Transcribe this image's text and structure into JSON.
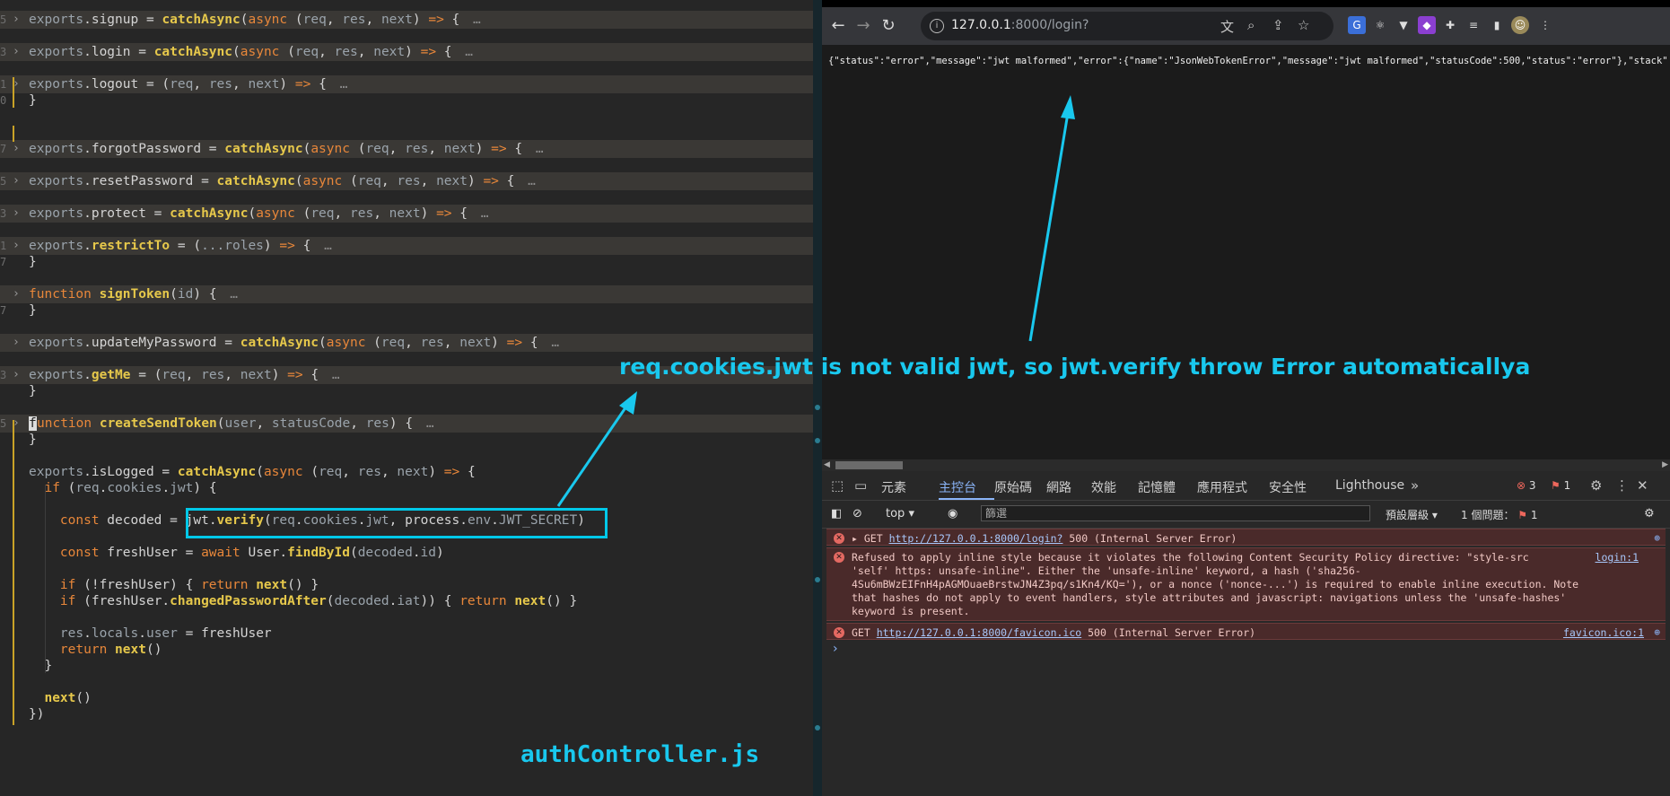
{
  "editor": {
    "filename_caption": "authController.js",
    "lines": [
      {
        "fold": true,
        "gutter": "5",
        "segs": [
          [
            "exports",
            "p"
          ],
          [
            ".",
            ""
          ],
          [
            "signup",
            ""
          ],
          [
            " = ",
            ""
          ],
          [
            "catchAsync",
            "f"
          ],
          [
            "(",
            ""
          ],
          [
            "async",
            "k"
          ],
          [
            " (",
            ""
          ],
          [
            "req",
            "p"
          ],
          [
            ", ",
            ""
          ],
          [
            "res",
            "p"
          ],
          [
            ", ",
            ""
          ],
          [
            "next",
            "p"
          ],
          [
            ") ",
            ""
          ],
          [
            "=>",
            "k"
          ],
          [
            " { ",
            ""
          ]
        ]
      },
      {
        "fold": true,
        "gutter": "3",
        "segs": [
          [
            "exports",
            "p"
          ],
          [
            ".",
            ""
          ],
          [
            "login",
            ""
          ],
          [
            " = ",
            ""
          ],
          [
            "catchAsync",
            "f"
          ],
          [
            "(",
            ""
          ],
          [
            "async",
            "k"
          ],
          [
            " (",
            ""
          ],
          [
            "req",
            "p"
          ],
          [
            ", ",
            ""
          ],
          [
            "res",
            "p"
          ],
          [
            ", ",
            ""
          ],
          [
            "next",
            "p"
          ],
          [
            ") ",
            ""
          ],
          [
            "=>",
            "k"
          ],
          [
            " { ",
            ""
          ]
        ]
      },
      {
        "fold": true,
        "gutter": "1",
        "segs": [
          [
            "exports",
            "p"
          ],
          [
            ".",
            ""
          ],
          [
            "logout",
            ""
          ],
          [
            " = (",
            ""
          ],
          [
            "req",
            "p"
          ],
          [
            ", ",
            ""
          ],
          [
            "res",
            "p"
          ],
          [
            ", ",
            ""
          ],
          [
            "next",
            "p"
          ],
          [
            ") ",
            ""
          ],
          [
            "=>",
            "k"
          ],
          [
            " { ",
            ""
          ]
        ]
      },
      {
        "fold": false,
        "gutter": "0",
        "segs": [
          [
            "}",
            ""
          ]
        ]
      },
      {
        "fold": false,
        "gutter": "",
        "segs": []
      },
      {
        "fold": true,
        "gutter": "7",
        "segs": [
          [
            "exports",
            "p"
          ],
          [
            ".",
            ""
          ],
          [
            "forgotPassword",
            ""
          ],
          [
            " = ",
            ""
          ],
          [
            "catchAsync",
            "f"
          ],
          [
            "(",
            ""
          ],
          [
            "async",
            "k"
          ],
          [
            " (",
            ""
          ],
          [
            "req",
            "p"
          ],
          [
            ", ",
            ""
          ],
          [
            "res",
            "p"
          ],
          [
            ", ",
            ""
          ],
          [
            "next",
            "p"
          ],
          [
            ") ",
            ""
          ],
          [
            "=>",
            "k"
          ],
          [
            " { ",
            ""
          ]
        ]
      },
      {
        "fold": true,
        "gutter": "5",
        "segs": [
          [
            "exports",
            "p"
          ],
          [
            ".",
            ""
          ],
          [
            "resetPassword",
            ""
          ],
          [
            " = ",
            ""
          ],
          [
            "catchAsync",
            "f"
          ],
          [
            "(",
            ""
          ],
          [
            "async",
            "k"
          ],
          [
            " (",
            ""
          ],
          [
            "req",
            "p"
          ],
          [
            ", ",
            ""
          ],
          [
            "res",
            "p"
          ],
          [
            ", ",
            ""
          ],
          [
            "next",
            "p"
          ],
          [
            ") ",
            ""
          ],
          [
            "=>",
            "k"
          ],
          [
            " { ",
            ""
          ]
        ]
      },
      {
        "fold": true,
        "gutter": "3",
        "segs": [
          [
            "exports",
            "p"
          ],
          [
            ".",
            ""
          ],
          [
            "protect",
            ""
          ],
          [
            " = ",
            ""
          ],
          [
            "catchAsync",
            "f"
          ],
          [
            "(",
            ""
          ],
          [
            "async",
            "k"
          ],
          [
            " (",
            ""
          ],
          [
            "req",
            "p"
          ],
          [
            ", ",
            ""
          ],
          [
            "res",
            "p"
          ],
          [
            ", ",
            ""
          ],
          [
            "next",
            "p"
          ],
          [
            ") ",
            ""
          ],
          [
            "=>",
            "k"
          ],
          [
            " { ",
            ""
          ]
        ]
      },
      {
        "fold": true,
        "gutter": "1",
        "segs": [
          [
            "exports",
            "p"
          ],
          [
            ".",
            ""
          ],
          [
            "restrictTo",
            "f"
          ],
          [
            " = (",
            ""
          ],
          [
            "...roles",
            "p"
          ],
          [
            ") ",
            ""
          ],
          [
            "=>",
            "k"
          ],
          [
            " { ",
            ""
          ]
        ]
      },
      {
        "fold": false,
        "gutter": "7",
        "segs": [
          [
            "}",
            ""
          ]
        ]
      },
      {
        "fold": true,
        "gutter": "",
        "segs": [
          [
            "function",
            "k"
          ],
          [
            " ",
            ""
          ],
          [
            "signToken",
            "f"
          ],
          [
            "(",
            ""
          ],
          [
            "id",
            "p"
          ],
          [
            ") { ",
            ""
          ]
        ]
      },
      {
        "fold": false,
        "gutter": "7",
        "segs": [
          [
            "}",
            ""
          ]
        ]
      },
      {
        "fold": true,
        "gutter": "",
        "segs": [
          [
            "exports",
            "p"
          ],
          [
            ".",
            ""
          ],
          [
            "updateMyPassword",
            ""
          ],
          [
            " = ",
            ""
          ],
          [
            "catchAsync",
            "f"
          ],
          [
            "(",
            ""
          ],
          [
            "async",
            "k"
          ],
          [
            " (",
            ""
          ],
          [
            "req",
            "p"
          ],
          [
            ", ",
            ""
          ],
          [
            "res",
            "p"
          ],
          [
            ", ",
            ""
          ],
          [
            "next",
            "p"
          ],
          [
            ") ",
            ""
          ],
          [
            "=>",
            "k"
          ],
          [
            " { ",
            ""
          ]
        ]
      },
      {
        "fold": true,
        "gutter": "3",
        "segs": [
          [
            "exports",
            "p"
          ],
          [
            ".",
            ""
          ],
          [
            "getMe",
            "f"
          ],
          [
            " = (",
            ""
          ],
          [
            "req",
            "p"
          ],
          [
            ", ",
            ""
          ],
          [
            "res",
            "p"
          ],
          [
            ", ",
            ""
          ],
          [
            "next",
            "p"
          ],
          [
            ") ",
            ""
          ],
          [
            "=>",
            "k"
          ],
          [
            " { ",
            ""
          ]
        ]
      },
      {
        "fold": false,
        "gutter": "",
        "segs": [
          [
            "}",
            ""
          ]
        ]
      },
      {
        "fold": true,
        "gutter": "5",
        "cursor": true,
        "segs": [
          [
            "unction",
            "k"
          ],
          [
            " ",
            ""
          ],
          [
            "createSendToken",
            "f"
          ],
          [
            "(",
            ""
          ],
          [
            "user",
            "p"
          ],
          [
            ", ",
            ""
          ],
          [
            "statusCode",
            "p"
          ],
          [
            ", ",
            ""
          ],
          [
            "res",
            "p"
          ],
          [
            ") { ",
            ""
          ]
        ]
      },
      {
        "fold": false,
        "gutter": "",
        "segs": [
          [
            "}",
            ""
          ]
        ]
      },
      {
        "fold": false,
        "gutter": "",
        "segs": [
          [
            "exports",
            "p"
          ],
          [
            ".",
            ""
          ],
          [
            "isLogged",
            ""
          ],
          [
            " = ",
            ""
          ],
          [
            "catchAsync",
            "f"
          ],
          [
            "(",
            ""
          ],
          [
            "async",
            "k"
          ],
          [
            " (",
            ""
          ],
          [
            "req",
            "p"
          ],
          [
            ", ",
            ""
          ],
          [
            "res",
            "p"
          ],
          [
            ", ",
            ""
          ],
          [
            "next",
            "p"
          ],
          [
            ") ",
            ""
          ],
          [
            "=>",
            "k"
          ],
          [
            " {",
            ""
          ]
        ]
      },
      {
        "fold": false,
        "gutter": "",
        "segs": [
          [
            "  if",
            "k"
          ],
          [
            " (",
            ""
          ],
          [
            "req",
            "p"
          ],
          [
            ".",
            ""
          ],
          [
            "cookies",
            "p"
          ],
          [
            ".",
            ""
          ],
          [
            "jwt",
            "p"
          ],
          [
            ") {",
            ""
          ]
        ]
      },
      {
        "fold": false,
        "gutter": "",
        "segs": [
          [
            "    const",
            "k"
          ],
          [
            " decoded = ",
            ""
          ],
          [
            "jwt",
            ""
          ],
          [
            ".",
            ""
          ],
          [
            "verify",
            "f"
          ],
          [
            "(",
            ""
          ],
          [
            "req",
            "p"
          ],
          [
            ".",
            ""
          ],
          [
            "cookies",
            "p"
          ],
          [
            ".",
            ""
          ],
          [
            "jwt",
            "p"
          ],
          [
            ", ",
            ""
          ],
          [
            "process",
            ""
          ],
          [
            ".",
            ""
          ],
          [
            "env",
            "p"
          ],
          [
            ".",
            ""
          ],
          [
            "JWT_SECRET",
            "p"
          ],
          [
            ")",
            ""
          ]
        ]
      },
      {
        "fold": false,
        "gutter": "",
        "segs": [
          [
            "    const",
            "k"
          ],
          [
            " freshUser = ",
            ""
          ],
          [
            "await",
            "k"
          ],
          [
            " User.",
            ""
          ],
          [
            "findById",
            "f"
          ],
          [
            "(",
            ""
          ],
          [
            "decoded",
            "p"
          ],
          [
            ".",
            ""
          ],
          [
            "id",
            "p"
          ],
          [
            ")",
            ""
          ]
        ]
      },
      {
        "fold": false,
        "gutter": "",
        "segs": [
          [
            "    if",
            "k"
          ],
          [
            " (!freshUser) { ",
            ""
          ],
          [
            "return",
            "k"
          ],
          [
            " ",
            ""
          ],
          [
            "next",
            "f"
          ],
          [
            "() }",
            ""
          ]
        ]
      },
      {
        "fold": false,
        "gutter": "",
        "segs": [
          [
            "    if",
            "k"
          ],
          [
            " (freshUser.",
            ""
          ],
          [
            "changedPasswordAfter",
            "f"
          ],
          [
            "(",
            ""
          ],
          [
            "decoded",
            "p"
          ],
          [
            ".",
            ""
          ],
          [
            "iat",
            "p"
          ],
          [
            ")) { ",
            ""
          ],
          [
            "return",
            "k"
          ],
          [
            " ",
            ""
          ],
          [
            "next",
            "f"
          ],
          [
            "() }",
            ""
          ]
        ]
      },
      {
        "fold": false,
        "gutter": "",
        "segs": [
          [
            "    res",
            "p"
          ],
          [
            ".",
            ""
          ],
          [
            "locals",
            "p"
          ],
          [
            ".",
            ""
          ],
          [
            "user",
            "p"
          ],
          [
            " = freshUser",
            ""
          ]
        ]
      },
      {
        "fold": false,
        "gutter": "",
        "segs": [
          [
            "    return",
            "k"
          ],
          [
            " ",
            ""
          ],
          [
            "next",
            "f"
          ],
          [
            "()",
            ""
          ]
        ]
      },
      {
        "fold": false,
        "gutter": "",
        "segs": [
          [
            "  }",
            ""
          ]
        ]
      },
      {
        "fold": false,
        "gutter": "",
        "segs": [
          [
            "  next",
            "f"
          ],
          [
            "()",
            ""
          ]
        ]
      },
      {
        "fold": false,
        "gutter": "",
        "segs": [
          [
            "})",
            ""
          ]
        ]
      }
    ],
    "ellipsis": "…"
  },
  "annotation": {
    "text": "req.cookies.jwt is not valid jwt, so jwt.verify throw Error automaticallya"
  },
  "browser": {
    "url_host": "127.0.0.1",
    "url_rest": ":8000/login?",
    "page_text": "{\"status\":\"error\",\"message\":\"jwt malformed\",\"error\":{\"name\":\"JsonWebTokenError\",\"message\":\"jwt malformed\",\"statusCode\":500,\"status\":\"error\"},\"stack\":\"",
    "nav_icons": [
      "back-icon",
      "forward-icon",
      "reload-icon"
    ]
  },
  "devtools": {
    "tabs": [
      "元素",
      "主控台",
      "原始碼",
      "網路",
      "效能",
      "記憶體",
      "應用程式",
      "安全性",
      "Lighthouse"
    ],
    "active_tab": "主控台",
    "error_count": "3",
    "issue_count": "1",
    "context": "top",
    "filter_placeholder": "篩選",
    "levels": "預設層級",
    "issues_label": "1 個問題：",
    "issues_badge": "1",
    "messages": [
      {
        "prefix": "GET ",
        "link": "http://127.0.0.1:8000/login?",
        "suffix": " 500 (Internal Server Error)",
        "source": ""
      },
      {
        "text": "Refused to apply inline style because it violates the following Content Security Policy directive: \"style-src\n'self' https: unsafe-inline\". Either the 'unsafe-inline' keyword, a hash ('sha256-\n4Su6mBWzEIFnH4pAGMOuaeBrstwJN4Z3pq/s1Kn4/KQ='), or a nonce ('nonce-...') is required to enable inline execution. Note\nthat hashes do not apply to event handlers, style attributes and javascript: navigations unless the 'unsafe-hashes'\nkeyword is present.",
        "source": "login:1"
      },
      {
        "prefix": "GET ",
        "link": "http://127.0.0.1:8000/favicon.ico",
        "suffix": " 500 (Internal Server Error)",
        "source": "favicon.ico:1"
      }
    ]
  },
  "colors": {
    "accent": "#19c8ee",
    "keyword": "#e8873a",
    "function": "#e6c84b",
    "error_bg": "#4a2a2a"
  }
}
